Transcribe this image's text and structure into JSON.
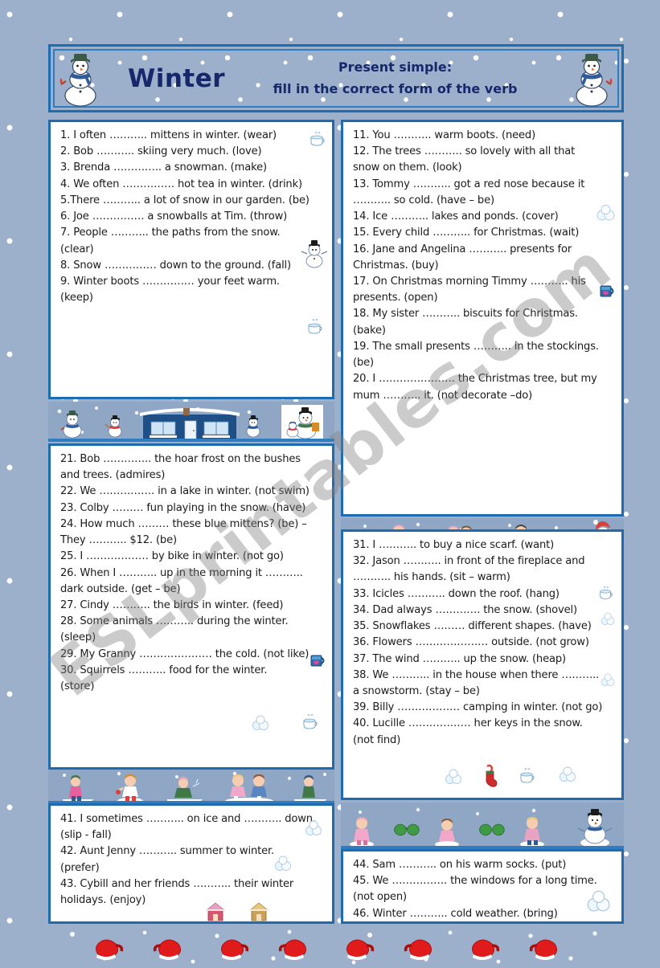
{
  "header": {
    "title": "Winter",
    "subtitle_line1": "Present simple:",
    "subtitle_line2": "fill in the correct form of the verb",
    "left_icon": "snowman-icon",
    "right_icon": "snowman-icon",
    "title_color": "#16276b",
    "border_color": "#1f6bb0",
    "background_color": "#9db0cb"
  },
  "watermark": {
    "text": "ESLprintables.com",
    "color": "#7d7d7d"
  },
  "panels": {
    "panel_a": {
      "name": "questions-1-9",
      "items": [
        "1. I often ……….. mittens in winter. (wear)",
        "2. Bob ……….. skiing very much. (love)",
        "3. Brenda ………….. a snowman. (make)",
        "4. We often …………… hot tea in winter. (drink)",
        "5.There ……….. a lot of snow in our garden. (be)",
        "6. Joe …………… a snowballs at Tim. (throw)",
        "7. People ……….. the paths from the snow.\n(clear)",
        "8. Snow …………… down to the ground. (fall)",
        "9. Winter boots …………… your feet warm.\n(keep)"
      ]
    },
    "panel_b": {
      "name": "questions-11-20",
      "items": [
        "11. You ……….. warm boots. (need)",
        "12. The trees ……….. so lovely with all that\nsnow on them. (look)",
        "13. Tommy ……….. got a red nose because it\n……….. so cold. (have – be)",
        "14. Ice ……….. lakes and ponds. (cover)",
        "15. Every child ……….. for Christmas. (wait)",
        "16. Jane and Angelina ……….. presents for\nChristmas. (buy)",
        "17. On Christmas morning Timmy ……….. his\npresents. (open)",
        "18. My sister ……….. biscuits for Christmas.\n(bake)",
        "19. The small presents ……….. in the stockings.\n(be)",
        "20. I …………………. the Christmas tree, but my\nmum ……….. it. (not decorate –do)"
      ]
    },
    "panel_c": {
      "name": "questions-21-30",
      "items": [
        "21. Bob ………….. the hoar frost on the bushes\nand trees. (admires)",
        "22. We ……………. in a lake in winter. (not swim)",
        "23. Colby ……… fun playing in the snow. (have)",
        "24. How much ……… these blue mittens? (be) –\nThey ……….. $12. (be)",
        "25. I ……………… by bike in winter. (not go)",
        "26. When I ……….. up in the morning it ………..\ndark outside. (get – be)",
        "27. Cindy ……….. the birds in winter. (feed)",
        "28. Some animals ……….. during the winter.\n(sleep)",
        "29. My Granny ………………… the cold. (not like)",
        "30. Squirrels ……….. food for the winter.\n(store)"
      ]
    },
    "panel_d": {
      "name": "questions-31-40",
      "items": [
        "31. I ……….. to buy a nice scarf. (want)",
        "32. Jason ……….. in front of the fireplace and\n……….. his hands. (sit – warm)",
        "33. Icicles ……….. down the roof. (hang)",
        "34. Dad always …………. the snow. (shovel)",
        "35. Snowflakes ……… different shapes. (have)",
        "36. Flowers ………………… outside. (not grow)",
        "37. The wind ……….. up the snow. (heap)",
        "38. We ……….. in the house when there ………..\na snowstorm. (stay – be)",
        "39. Billy ……………… camping in winter. (not go)",
        "40. Lucille ……………… her keys in the snow.\n(not find)"
      ]
    },
    "panel_e": {
      "name": "questions-41-43",
      "items": [
        "41. I sometimes ……….. on ice and ……….. down.\n(slip - fall)",
        "42. Aunt Jenny ……….. summer to winter.\n(prefer)",
        "43. Cybill and her friends ……….. their winter\nholidays. (enjoy)"
      ]
    },
    "panel_f": {
      "name": "questions-44-46",
      "items": [
        "44. Sam ……….. on his warm socks. (put)",
        "45. We ……………. the windows for a long time.\n(not open)",
        "46. Winter ……….. cold weather. (bring)"
      ]
    }
  },
  "decorations": {
    "strip_snowmen": "snowmen-and-blue-house-border",
    "strip_kids_1": "children-playing-in-snow-border",
    "strip_kids_2": "children-sledding-and-skating-border",
    "strip_kids_3": "children-winter-play-border",
    "strip_mittens": "red-mittens-border",
    "small_icons": [
      "hot-cocoa-cup-icon",
      "snowman-icon",
      "snowballs-icon",
      "blue-mug-icon",
      "christmas-stocking-icon",
      "santa-hat-snowman-icon"
    ]
  }
}
